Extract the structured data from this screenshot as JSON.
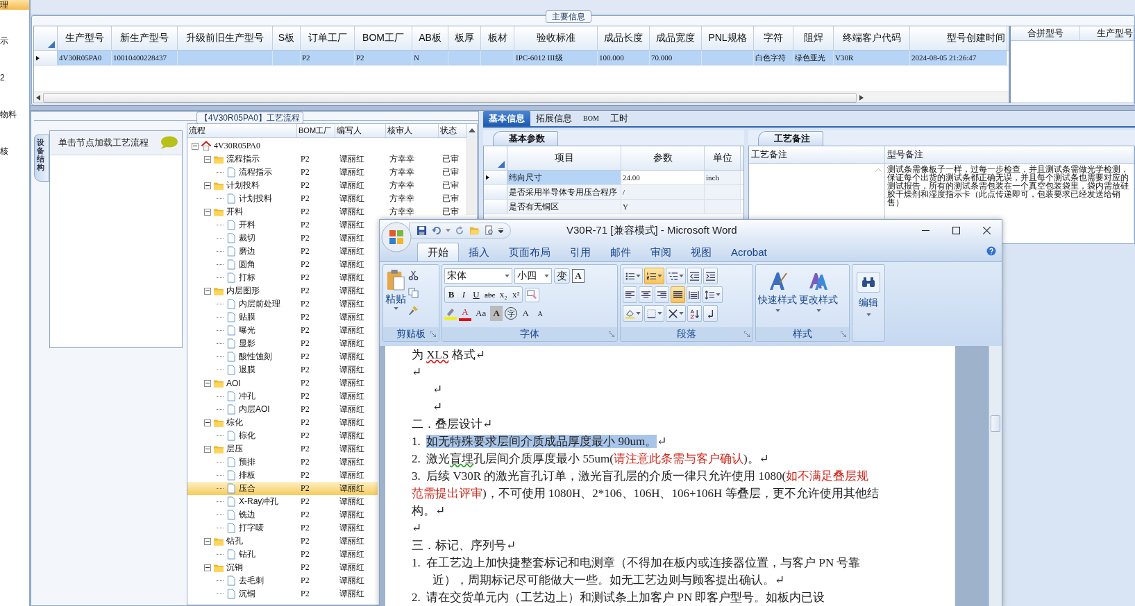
{
  "sidebar": {
    "items": [
      {
        "label": "理",
        "selected": true
      },
      {
        "label": "示",
        "selected": false
      },
      {
        "label": "2",
        "selected": false
      },
      {
        "label": "物料",
        "selected": false
      },
      {
        "label": "核",
        "selected": false
      }
    ]
  },
  "main_info": {
    "title": "主要信息",
    "table": {
      "columns": [
        "生产型号",
        "新生产型号",
        "升级前旧生产型号",
        "S板",
        "订单工厂",
        "BOM工厂",
        "AB板",
        "板厚",
        "板材",
        "验收标准",
        "成品长度",
        "成品宽度",
        "PNL规格",
        "字符",
        "阻焊",
        "终端客户代码",
        "型号创建时间"
      ],
      "rows": [
        {
          "selected": true,
          "cells": [
            "4V30R05PA0",
            "10010400228437",
            "",
            "",
            "P2",
            "P2",
            "N",
            "",
            "",
            "IPC-6012 III级",
            "100.000",
            "70.000",
            "",
            "白色字符",
            "绿色亚光",
            "V30R",
            "2024-08-05 21:26:47"
          ]
        }
      ]
    },
    "side_table": {
      "columns": [
        "合拼型号",
        "生产型号"
      ]
    }
  },
  "process": {
    "title": "【4V30R05PA0】工艺流程",
    "vertical_tab": "设备结构",
    "hint": "单击节点加载工艺流程",
    "tree": {
      "columns": [
        "流程",
        "BOM工厂",
        "编写人",
        "核审人",
        "状态"
      ],
      "root": {
        "label": "4V30R05PA0",
        "kind": "root",
        "expanded": true,
        "selected": false,
        "children": [
          {
            "label": "流程指示",
            "kind": "folder",
            "expanded": true,
            "selected": false,
            "bom": "P2",
            "author": "谭丽红",
            "approver": "方幸幸",
            "status": "已审",
            "children": [
              {
                "label": "流程指示",
                "kind": "doc",
                "selected": false,
                "bom": "P2",
                "author": "谭丽红",
                "approver": "方幸幸",
                "status": "已审"
              }
            ]
          },
          {
            "label": "计划投料",
            "kind": "folder",
            "expanded": true,
            "selected": false,
            "bom": "P2",
            "author": "谭丽红",
            "approver": "方幸幸",
            "status": "已审",
            "children": [
              {
                "label": "计划投料",
                "kind": "doc",
                "selected": false,
                "bom": "P2",
                "author": "谭丽红",
                "approver": "方幸幸",
                "status": "已审"
              }
            ]
          },
          {
            "label": "开料",
            "kind": "folder",
            "expanded": true,
            "selected": false,
            "bom": "P2",
            "author": "谭丽红",
            "approver": "方幸幸",
            "status": "已审",
            "children": [
              {
                "label": "开料",
                "kind": "doc",
                "selected": false,
                "bom": "P2",
                "author": "谭丽红"
              },
              {
                "label": "裁切",
                "kind": "doc",
                "selected": false,
                "bom": "P2",
                "author": "谭丽红"
              },
              {
                "label": "磨边",
                "kind": "doc",
                "selected": false,
                "bom": "P2",
                "author": "谭丽红"
              },
              {
                "label": "圆角",
                "kind": "doc",
                "selected": false,
                "bom": "P2",
                "author": "谭丽红"
              },
              {
                "label": "打标",
                "kind": "doc",
                "selected": false,
                "bom": "P2",
                "author": "谭丽红"
              }
            ]
          },
          {
            "label": "内层图形",
            "kind": "folder",
            "expanded": true,
            "selected": false,
            "bom": "P2",
            "author": "谭丽红",
            "children": [
              {
                "label": "内层前处理",
                "kind": "doc",
                "selected": false,
                "bom": "P2",
                "author": "谭丽红"
              },
              {
                "label": "贴膜",
                "kind": "doc",
                "selected": false,
                "bom": "P2",
                "author": "谭丽红"
              },
              {
                "label": "曝光",
                "kind": "doc",
                "selected": false,
                "bom": "P2",
                "author": "谭丽红"
              },
              {
                "label": "显影",
                "kind": "doc",
                "selected": false,
                "bom": "P2",
                "author": "谭丽红"
              },
              {
                "label": "酸性蚀刻",
                "kind": "doc",
                "selected": false,
                "bom": "P2",
                "author": "谭丽红"
              },
              {
                "label": "退膜",
                "kind": "doc",
                "selected": false,
                "bom": "P2",
                "author": "谭丽红"
              }
            ]
          },
          {
            "label": "AOI",
            "kind": "folder",
            "expanded": true,
            "selected": false,
            "bom": "P2",
            "author": "谭丽红",
            "children": [
              {
                "label": "冲孔",
                "kind": "doc",
                "selected": false,
                "bom": "P2",
                "author": "谭丽红"
              },
              {
                "label": "内层AOI",
                "kind": "doc",
                "selected": false,
                "bom": "P2",
                "author": "谭丽红"
              }
            ]
          },
          {
            "label": "棕化",
            "kind": "folder",
            "expanded": true,
            "selected": false,
            "bom": "P2",
            "author": "谭丽红",
            "children": [
              {
                "label": "棕化",
                "kind": "doc",
                "selected": false,
                "bom": "P2",
                "author": "谭丽红"
              }
            ]
          },
          {
            "label": "层压",
            "kind": "folder",
            "expanded": true,
            "selected": false,
            "bom": "P2",
            "author": "谭丽红",
            "children": [
              {
                "label": "预排",
                "kind": "doc",
                "selected": false,
                "bom": "P2",
                "author": "谭丽红"
              },
              {
                "label": "排板",
                "kind": "doc",
                "selected": false,
                "bom": "P2",
                "author": "谭丽红"
              },
              {
                "label": "压合",
                "kind": "doc",
                "selected": true,
                "bom": "P2",
                "author": "谭丽红"
              },
              {
                "label": "X-Ray冲孔",
                "kind": "doc",
                "selected": false,
                "bom": "P2",
                "author": "谭丽红"
              },
              {
                "label": "铣边",
                "kind": "doc",
                "selected": false,
                "bom": "P2",
                "author": "谭丽红"
              },
              {
                "label": "打字唛",
                "kind": "doc",
                "selected": false,
                "bom": "P2",
                "author": "谭丽红"
              }
            ]
          },
          {
            "label": "钻孔",
            "kind": "folder",
            "expanded": true,
            "selected": false,
            "bom": "P2",
            "author": "谭丽红",
            "children": [
              {
                "label": "钻孔",
                "kind": "doc",
                "selected": false,
                "bom": "P2",
                "author": "谭丽红"
              }
            ]
          },
          {
            "label": "沉铜",
            "kind": "folder",
            "expanded": true,
            "selected": false,
            "bom": "P2",
            "author": "谭丽红",
            "children": [
              {
                "label": "去毛刺",
                "kind": "doc",
                "selected": false,
                "bom": "P2",
                "author": "谭丽红"
              },
              {
                "label": "沉铜",
                "kind": "doc",
                "selected": false,
                "bom": "P2",
                "author": "谭丽红"
              }
            ]
          }
        ]
      }
    }
  },
  "detail_tabs": [
    {
      "label": "基本信息",
      "selected": true
    },
    {
      "label": "拓展信息",
      "selected": false
    },
    {
      "label": "BOM",
      "selected": false
    },
    {
      "label": "工时",
      "selected": false
    }
  ],
  "basic_params": {
    "tab": "基本参数",
    "columns": [
      "项目",
      "参数",
      "单位"
    ],
    "rows": [
      {
        "selected": true,
        "cells": [
          "纬向尺寸",
          "24.00",
          "inch"
        ]
      },
      {
        "selected": false,
        "cells": [
          "是否采用半导体专用压合程序",
          "/",
          ""
        ]
      },
      {
        "selected": false,
        "cells": [
          "是否有无铜区",
          "Y",
          ""
        ]
      }
    ]
  },
  "process_notes": {
    "tab": "工艺备注",
    "columns": [
      "工艺备注",
      "型号备注"
    ],
    "model_note": "测试条需像板子一样，过每一步检查，并且测试条需做光学检测，保证每个出货的测试条都正确无误，并且每个测试条也需要对应的测试报告，所有的测试条需包装在一个真空包装袋里，袋内需放硅胶干燥剂和湿度指示卡（此点传递即可，包装要求已经发送给销售）"
  },
  "word": {
    "title": "V30R-71 [兼容模式] - Microsoft Word",
    "tabs": [
      {
        "label": "开始",
        "selected": true
      },
      {
        "label": "插入",
        "selected": false
      },
      {
        "label": "页面布局",
        "selected": false
      },
      {
        "label": "引用",
        "selected": false
      },
      {
        "label": "邮件",
        "selected": false
      },
      {
        "label": "审阅",
        "selected": false
      },
      {
        "label": "视图",
        "selected": false
      },
      {
        "label": "Acrobat",
        "selected": false
      }
    ],
    "groups": {
      "clipboard": "剪贴板",
      "font": "字体",
      "paragraph": "段落",
      "styles": "样式"
    },
    "paste": "粘贴",
    "font_name": "宋体",
    "font_size": "小四",
    "font_row1": [
      {
        "label": "变",
        "kind": "phonetic"
      },
      {
        "label": "A",
        "kind": "border"
      }
    ],
    "font_row2": [
      {
        "label": "B",
        "kind": "bold"
      },
      {
        "label": "I",
        "kind": "italic"
      },
      {
        "label": "U",
        "kind": "underline"
      },
      {
        "label": "abc",
        "kind": "strike"
      },
      {
        "label": "x₂",
        "kind": "sub"
      },
      {
        "label": "x²",
        "kind": "sup"
      }
    ],
    "font_row3": [
      {
        "label": "A",
        "kind": "color"
      },
      {
        "label": "Aa",
        "kind": "case"
      },
      {
        "label": "A",
        "kind": "shade"
      },
      {
        "label": "字",
        "kind": "enclose"
      },
      {
        "label": "A",
        "kind": "grow"
      },
      {
        "label": "A",
        "kind": "shrink"
      }
    ],
    "para_buttons": [
      {
        "kind": "bullets",
        "on": false
      },
      {
        "kind": "numbering",
        "on": true
      },
      {
        "kind": "multilevel",
        "on": false
      },
      {
        "kind": "outdent",
        "on": false
      },
      {
        "kind": "indent",
        "on": false
      },
      {
        "kind": "left",
        "on": false
      },
      {
        "kind": "center",
        "on": false
      },
      {
        "kind": "right",
        "on": false
      },
      {
        "kind": "justify",
        "on": true
      },
      {
        "kind": "distribute",
        "on": false
      },
      {
        "kind": "spacing",
        "on": false
      },
      {
        "kind": "shading",
        "on": false
      },
      {
        "kind": "borders",
        "on": false
      },
      {
        "kind": "layout",
        "on": false
      },
      {
        "kind": "sort",
        "on": false
      },
      {
        "kind": "marks",
        "on": false
      }
    ],
    "styles": [
      "快速样式",
      "更改样式"
    ],
    "edit": "编辑",
    "paragraphs": [
      {
        "kind": "plain",
        "segments": [
          {
            "text": "为 ",
            "kind": "plain"
          },
          {
            "text": "XLS",
            "kind": "spelling"
          },
          {
            "text": " 格式↵",
            "kind": "plain"
          }
        ]
      },
      {
        "kind": "mark",
        "segments": [
          {
            "text": "↵",
            "kind": "plain"
          }
        ]
      },
      {
        "kind": "mark-indented",
        "segments": [
          {
            "text": "↵",
            "kind": "plain"
          }
        ]
      },
      {
        "kind": "mark-indented",
        "segments": [
          {
            "text": "↵",
            "kind": "plain"
          }
        ]
      },
      {
        "kind": "heading",
        "segments": [
          {
            "text": "二．叠层设计↵",
            "kind": "plain"
          }
        ]
      },
      {
        "kind": "item",
        "segments": [
          {
            "text": "1.  ",
            "kind": "plain"
          },
          {
            "text": "如无特殊要求层间介质成品厚度最小 90um。",
            "kind": "selected"
          },
          {
            "text": "↵",
            "kind": "plain"
          }
        ]
      },
      {
        "kind": "item",
        "segments": [
          {
            "text": "2.  激光",
            "kind": "plain"
          },
          {
            "text": "盲埋",
            "kind": "grammar"
          },
          {
            "text": "孔层间介质厚度最小 55um(",
            "kind": "plain"
          },
          {
            "text": "请注意此条需与客户确认",
            "kind": "red"
          },
          {
            "text": ")。↵",
            "kind": "plain"
          }
        ]
      },
      {
        "kind": "item",
        "segments": [
          {
            "text": "3.  后续 V30R 的激光盲孔订单，激光盲孔层的介质一律只允许使用 1080(",
            "kind": "plain"
          },
          {
            "text": "如不满足叠层规范需提出评审",
            "kind": "red"
          },
          {
            "text": ")，不可使用 1080H、2*106、106H、106+106H 等叠层，更不允许使用其他结构。↵",
            "kind": "plain"
          }
        ]
      },
      {
        "kind": "mark",
        "segments": [
          {
            "text": "↵",
            "kind": "plain"
          }
        ]
      },
      {
        "kind": "heading",
        "segments": [
          {
            "text": "三．标记、序列号↵",
            "kind": "plain"
          }
        ]
      },
      {
        "kind": "item-hanging",
        "segments": [
          {
            "text": "1.  在工艺边上加快捷整套标记和电测章（不得加在板内或连接器位置，与客户 PN 号靠近），周期标记尽可能做大一些。如无工艺边则与顾客提出确认。↵",
            "kind": "plain"
          }
        ]
      },
      {
        "kind": "item-hanging",
        "segments": [
          {
            "text": "2.  请在交货单元内（工艺边上）和测试条上加客户 PN 即客户型号。如板内已设",
            "kind": "plain"
          }
        ]
      }
    ]
  }
}
